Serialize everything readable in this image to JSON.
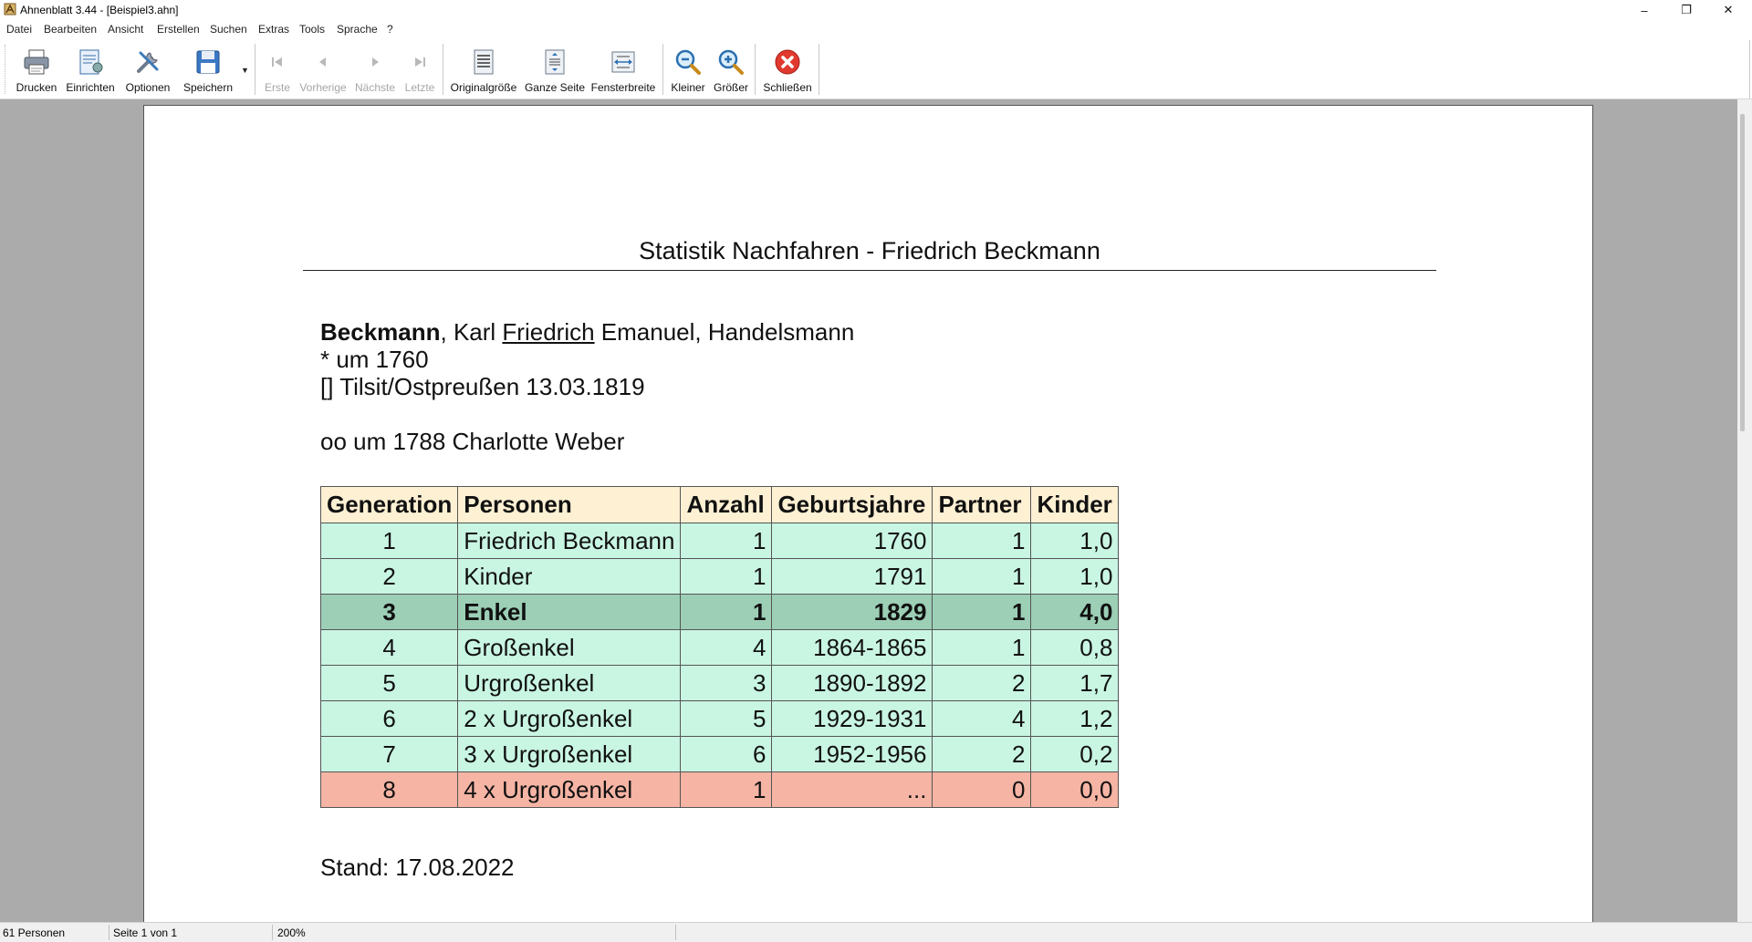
{
  "window": {
    "title": "Ahnenblatt 3.44 - [Beispiel3.ahn]",
    "minimize": "–",
    "maximize": "❐",
    "close": "✕"
  },
  "menu": [
    "Datei",
    "Bearbeiten",
    "Ansicht",
    "Erstellen",
    "Suchen",
    "Extras",
    "Tools",
    "Sprache",
    "?"
  ],
  "toolbar": {
    "print": "Drucken",
    "setup": "Einrichten",
    "options": "Optionen",
    "save": "Speichern",
    "first": "Erste",
    "previous": "Vorherige",
    "next": "Nächste",
    "last": "Letzte",
    "original_size": "Originalgröße",
    "whole_page": "Ganze Seite",
    "window_width": "Fensterbreite",
    "smaller": "Kleiner",
    "larger": "Größer",
    "close": "Schließen"
  },
  "document": {
    "title": "Statistik Nachfahren - Friedrich Beckmann",
    "person": {
      "surname": "Beckmann",
      "given_before": ", Karl ",
      "callname": "Friedrich",
      "given_after": " Emanuel, Handelsmann",
      "birth": "* um 1760",
      "death": "[] Tilsit/Ostpreußen 13.03.1819",
      "marriage": "oo um 1788 Charlotte Weber"
    },
    "table": {
      "headers": [
        "Generation",
        "Personen",
        "Anzahl",
        "Geburtsjahre",
        "Partner",
        "Kinder"
      ],
      "rows": [
        {
          "generation": "1",
          "personen": "Friedrich Beckmann",
          "anzahl": "1",
          "geburtsjahre": "1760",
          "partner": "1",
          "kinder": "1,0"
        },
        {
          "generation": "2",
          "personen": "Kinder",
          "anzahl": "1",
          "geburtsjahre": "1791",
          "partner": "1",
          "kinder": "1,0"
        },
        {
          "generation": "3",
          "personen": "Enkel",
          "anzahl": "1",
          "geburtsjahre": "1829",
          "partner": "1",
          "kinder": "4,0"
        },
        {
          "generation": "4",
          "personen": "Großenkel",
          "anzahl": "4",
          "geburtsjahre": "1864-1865",
          "partner": "1",
          "kinder": "0,8"
        },
        {
          "generation": "5",
          "personen": "Urgroßenkel",
          "anzahl": "3",
          "geburtsjahre": "1890-1892",
          "partner": "2",
          "kinder": "1,7"
        },
        {
          "generation": "6",
          "personen": "2 x Urgroßenkel",
          "anzahl": "5",
          "geburtsjahre": "1929-1931",
          "partner": "4",
          "kinder": "1,2"
        },
        {
          "generation": "7",
          "personen": "3 x Urgroßenkel",
          "anzahl": "6",
          "geburtsjahre": "1952-1956",
          "partner": "2",
          "kinder": "0,2"
        },
        {
          "generation": "8",
          "personen": "4 x Urgroßenkel",
          "anzahl": "1",
          "geburtsjahre": "...",
          "partner": "0",
          "kinder": "0,0"
        }
      ]
    },
    "stand": "Stand: 17.08.2022"
  },
  "status": {
    "persons": "61 Personen",
    "page": "Seite 1 von 1",
    "zoom": "200%"
  },
  "colors": {
    "header_bg": "#fdf0d3",
    "row_bg": "#c9f5e3",
    "highlight_bg": "#9ccfb6",
    "last_row_bg": "#f5b4a4",
    "workspace_bg": "#ababab"
  }
}
